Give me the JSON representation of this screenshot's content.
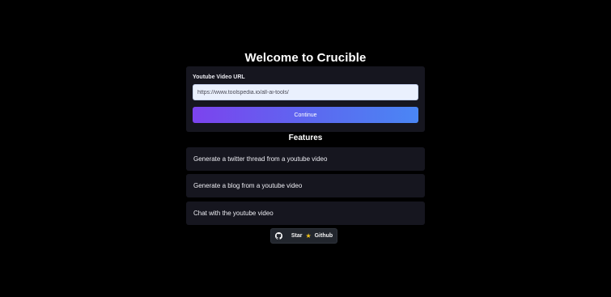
{
  "title": "Welcome to Crucible",
  "url_form": {
    "label": "Youtube Video URL",
    "value": "https://www.toolspedia.io/all-ai-tools/",
    "continue_label": "Continue"
  },
  "features": {
    "heading": "Features",
    "items": [
      {
        "label": "Generate a twitter thread from a youtube video"
      },
      {
        "label": "Generate a blog from a youtube video"
      },
      {
        "label": "Chat with the youtube video"
      }
    ]
  },
  "github_button": {
    "star_label": "Star",
    "star_icon": "star-icon",
    "github_label": "Github",
    "icon": "github-icon"
  },
  "colors": {
    "background": "#000000",
    "card": "#16161f",
    "button_gradient_start": "#7c43ee",
    "button_gradient_end": "#4a86f4",
    "star": "#f5c518"
  }
}
